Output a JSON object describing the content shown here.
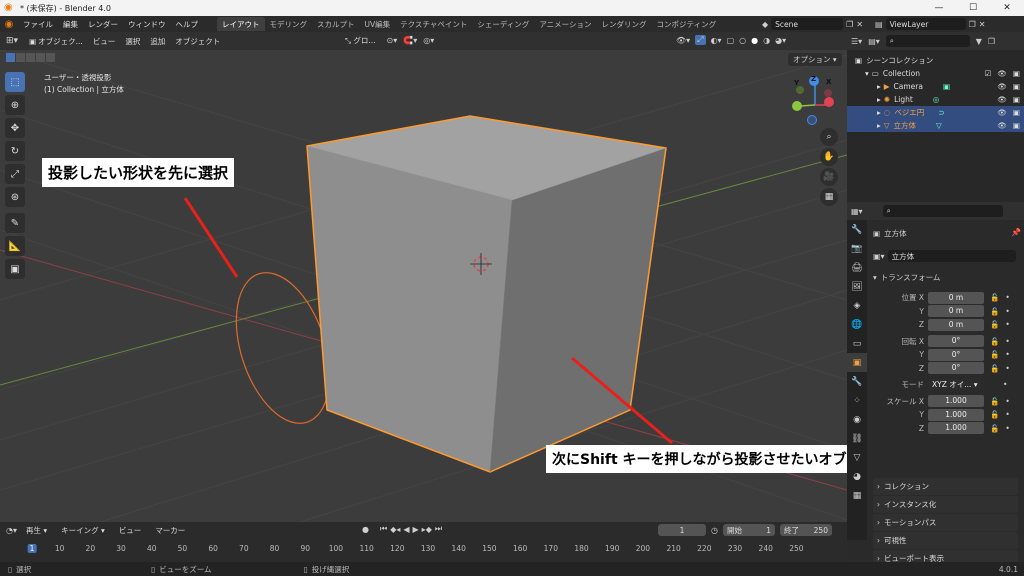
{
  "window": {
    "title": "* (未保存) - Blender 4.0",
    "min": "—",
    "max": "☐",
    "close": "✕"
  },
  "menu": [
    "ファイル",
    "編集",
    "レンダー",
    "ウィンドウ",
    "ヘルプ"
  ],
  "workspaces": [
    "レイアウト",
    "モデリング",
    "スカルプト",
    "UV編集",
    "テクスチャペイント",
    "シェーディング",
    "アニメーション",
    "レンダリング",
    "コンポジティング"
  ],
  "scene": {
    "name": "Scene",
    "view_layer": "ViewLayer"
  },
  "viewport_header": {
    "mode": "オブジェク...",
    "items": [
      "ビュー",
      "選択",
      "追加",
      "オブジェクト"
    ],
    "transform": "グロ...",
    "options": "オプション"
  },
  "viewport": {
    "view_name": "ユーザー・透視投影",
    "collection_info": "(1) Collection | 立方体",
    "axis": {
      "x": "X",
      "y": "Y",
      "z": "Z"
    }
  },
  "callouts": {
    "first": "投影したい形状を先に選択",
    "second": "次にShift キーを押しながら投影させたいオブジェクトを選択"
  },
  "colors": {
    "accent": "#4772b3",
    "selected": "#ff9a2e",
    "callout_line": "#e8201c",
    "x_axis": "#e44155",
    "y_axis": "#8cc63f",
    "z_axis": "#3d8ee6"
  },
  "outliner": {
    "scene_collection": "シーンコレクション",
    "rows": [
      {
        "label": "Collection",
        "icon": "collection-icon"
      },
      {
        "label": "Camera",
        "icon": "camera-icon"
      },
      {
        "label": "Light",
        "icon": "light-icon"
      },
      {
        "label": "ベジエ円",
        "icon": "curve-icon"
      },
      {
        "label": "立方体",
        "icon": "mesh-icon"
      }
    ]
  },
  "properties": {
    "object_name": "立方体",
    "data_name": "立方体",
    "transform_title": "トランスフォーム",
    "location": {
      "label": "位置",
      "x": "0 m",
      "y": "0 m",
      "z": "0 m"
    },
    "rotation": {
      "label": "回転",
      "x": "0°",
      "y": "0°",
      "z": "0°"
    },
    "mode": {
      "label": "モード",
      "value": "XYZ オイ..."
    },
    "scale": {
      "label": "スケール",
      "x": "1.000",
      "y": "1.000",
      "z": "1.000"
    },
    "axis_labels": {
      "x": "X",
      "y": "Y",
      "z": "Z"
    },
    "panels": [
      "コレクション",
      "インスタンス化",
      "モーションパス",
      "可視性",
      "ビューポート表示"
    ]
  },
  "timeline": {
    "playback": "再生",
    "keying": "キーイング",
    "view": "ビュー",
    "marker": "マーカー",
    "current_frame": "1",
    "start_label": "開始",
    "start": "1",
    "end_label": "終了",
    "end": "250",
    "ticks": [
      "1",
      "10",
      "20",
      "30",
      "40",
      "50",
      "60",
      "70",
      "80",
      "90",
      "100",
      "110",
      "120",
      "130",
      "140",
      "150",
      "160",
      "170",
      "180",
      "190",
      "200",
      "210",
      "220",
      "230",
      "240",
      "250"
    ]
  },
  "statusbar": {
    "select": "選択",
    "zoom": "ビューをズーム",
    "lasso": "投げ縄選択",
    "version": "4.0.1"
  }
}
